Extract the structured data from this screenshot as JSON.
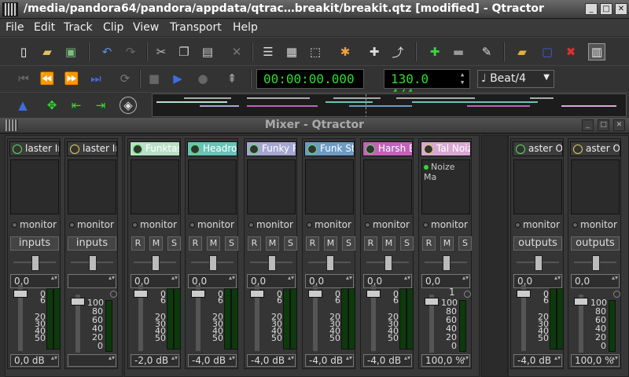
{
  "window": {
    "title": "/media/pandora64/pandora/appdata/qtrac…breakit/breakit.qtz [modified] - Qtractor",
    "buttons": [
      "_",
      "□",
      "✕"
    ]
  },
  "menu": [
    "File",
    "Edit",
    "Track",
    "Clip",
    "View",
    "Transport",
    "Help"
  ],
  "transport": {
    "time": "00:00:00.000",
    "tempo": "130.0 4/4",
    "snap": "Beat/4"
  },
  "mixer": {
    "title": "Mixer - Qtractor",
    "input_strips": [
      {
        "name": "laster In",
        "icon": "audio-wave-icon",
        "color": "#3c3c3c",
        "monitor": "monitor",
        "bus": "inputs",
        "gain": "0,0",
        "output": "0,0 dB"
      },
      {
        "name": "laster In",
        "icon": "midi-gear-icon",
        "color": "#3c3c3c",
        "monitor": "monitor",
        "bus": "inputs",
        "gain": "",
        "output": ""
      }
    ],
    "track_strips": [
      {
        "name": "Funktas",
        "icon": "audio-wave-icon",
        "color": "#b8e0c7",
        "monitor": "monitor",
        "gain": "0,0",
        "output": "-2,0 dB",
        "plugin": ""
      },
      {
        "name": "Headro",
        "icon": "audio-wave-icon",
        "color": "#69c3b7",
        "monitor": "monitor",
        "gain": "0,0",
        "output": "-4,0 dB",
        "plugin": ""
      },
      {
        "name": "Funky R",
        "icon": "audio-wave-icon",
        "color": "#a6a6d2",
        "monitor": "monitor",
        "gain": "0,0",
        "output": "-4,0 dB",
        "plugin": ""
      },
      {
        "name": "Funk St",
        "icon": "audio-wave-icon",
        "color": "#6e9bc4",
        "monitor": "monitor",
        "gain": "0,0",
        "output": "-4,0 dB",
        "plugin": ""
      },
      {
        "name": "Harsh E",
        "icon": "audio-wave-icon",
        "color": "#c561b8",
        "monitor": "monitor",
        "gain": "0,0",
        "output": "-4,0 dB",
        "plugin": ""
      },
      {
        "name": "Tal Noiz",
        "icon": "midi-gear-icon",
        "color": "#d8a8d2",
        "monitor": "monitor",
        "gain": "0,0",
        "output": "100,0 %",
        "plugin": "Noize Ma"
      }
    ],
    "output_strips": [
      {
        "name": "aster O",
        "icon": "audio-wave-icon",
        "color": "#3c3c3c",
        "monitor": "monitor",
        "bus": "outputs",
        "gain": "0,0",
        "output": "-4,0 dB"
      },
      {
        "name": "aster O",
        "icon": "midi-gear-icon",
        "color": "#3c3c3c",
        "monitor": "monitor",
        "bus": "outputs",
        "gain": "0,0",
        "output": "100,0 %"
      }
    ],
    "rms": [
      "R",
      "M",
      "S"
    ],
    "db_scale": [
      "0",
      "6",
      "20",
      "30",
      "40",
      "50"
    ],
    "midi_scale": [
      "100",
      "80",
      "60",
      "40",
      "20",
      "0"
    ],
    "midi_marker": "1"
  }
}
